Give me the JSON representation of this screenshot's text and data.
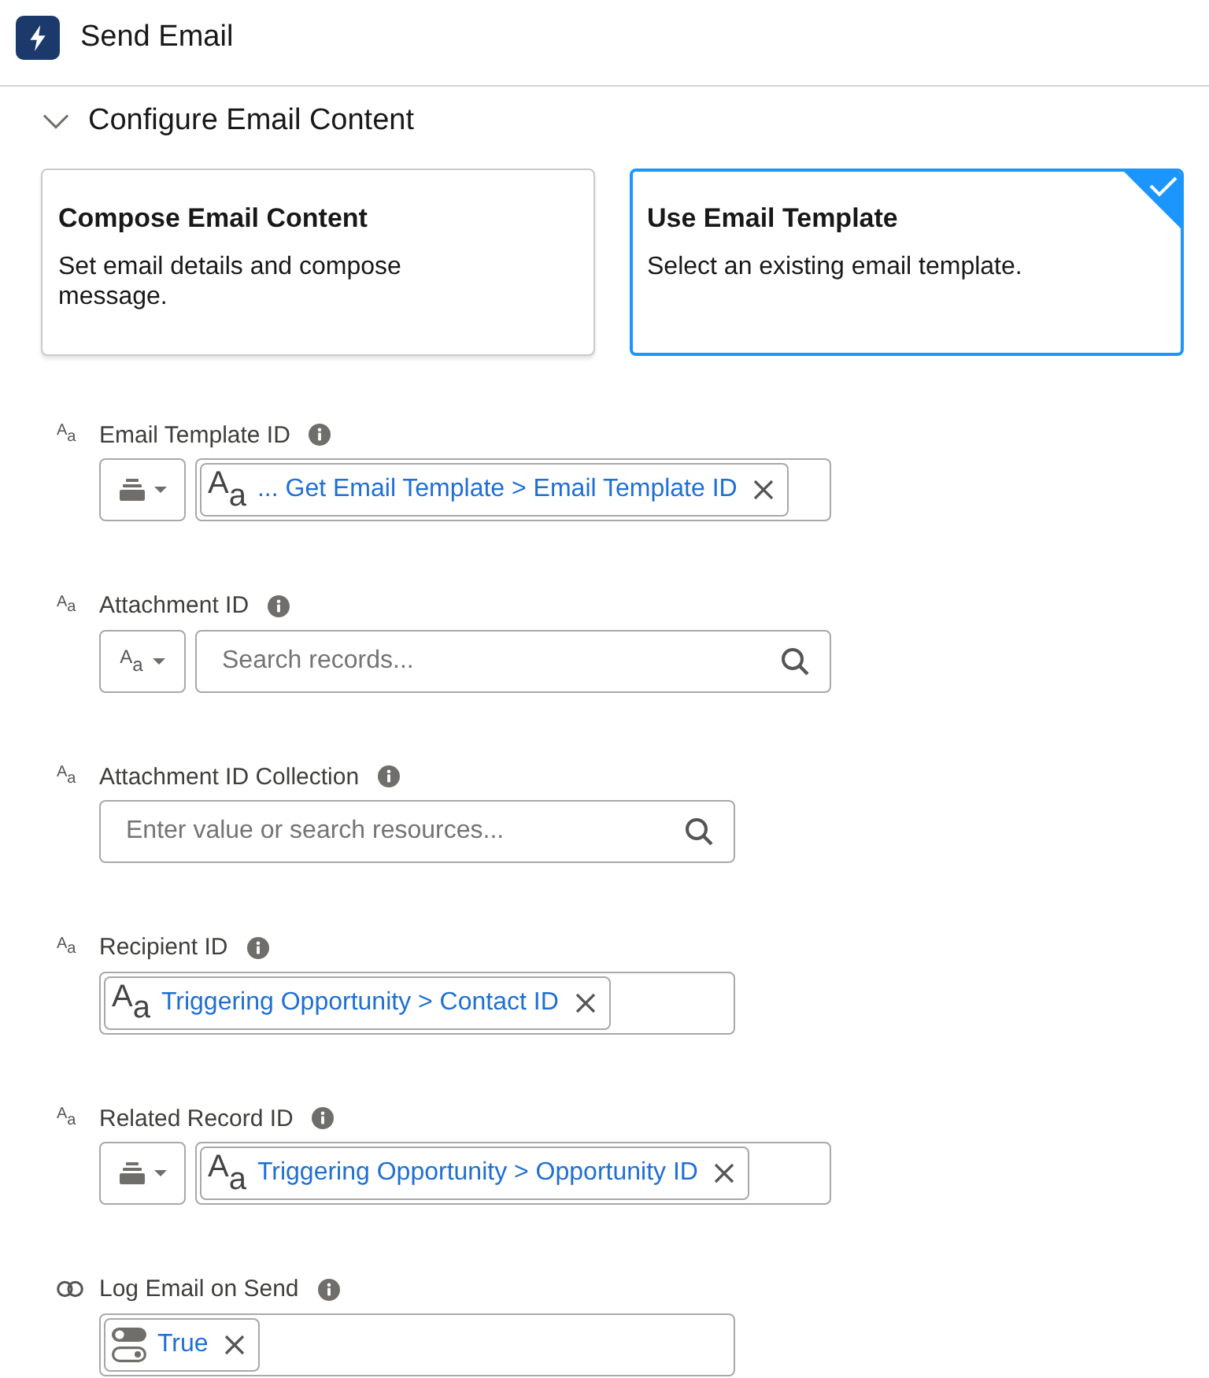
{
  "header": {
    "title": "Send Email"
  },
  "section": {
    "title": "Configure Email Content",
    "expanded": true
  },
  "options": [
    {
      "title": "Compose Email Content",
      "description": "Set email details and compose message.",
      "selected": false
    },
    {
      "title": "Use Email Template",
      "description": "Select an existing email template.",
      "selected": true
    }
  ],
  "fields": [
    {
      "label": "Email Template ID",
      "type_icon": {
        "kind": "text",
        "glyph": "A$_{a}$"
      },
      "mode": {
        "kind": "resource"
      },
      "value": {
        "icon": {
          "kind": "text",
          "glyph": "A$_{a}$"
        },
        "text": "... Get Email Template > Email Template ID"
      }
    },
    {
      "label": "Attachment ID",
      "type_icon": {
        "kind": "text",
        "glyph": "A$_{a}$"
      },
      "mode": {
        "kind": "text",
        "glyph": "A$_{a}$"
      },
      "placeholder": "Search records..."
    },
    {
      "label": "Attachment ID Collection",
      "type_icon": {
        "kind": "text",
        "glyph": "A$_{a}$"
      },
      "placeholder": "Enter value or search resources..."
    },
    {
      "label": "Recipient ID",
      "type_icon": {
        "kind": "text",
        "glyph": "A$_{a}$"
      },
      "value": {
        "icon": {
          "kind": "text",
          "glyph": "A$_{a}$"
        },
        "text": "Triggering Opportunity > Contact ID"
      }
    },
    {
      "label": "Related Record ID",
      "type_icon": {
        "kind": "text",
        "glyph": "A$_{a}$"
      },
      "mode": {
        "kind": "resource"
      },
      "value": {
        "icon": {
          "kind": "text",
          "glyph": "A$_{a}$"
        },
        "text": "Triggering Opportunity > Opportunity ID"
      }
    },
    {
      "label": "Log Email on Send",
      "type_icon": {
        "kind": "boolean"
      },
      "value": {
        "icon": {
          "kind": "boolean"
        },
        "text": "True"
      }
    }
  ]
}
